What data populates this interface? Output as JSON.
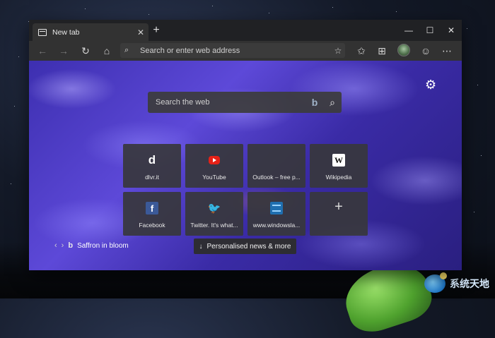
{
  "browser": {
    "tab": {
      "title": "New tab",
      "icon": "new-tab-page-icon"
    },
    "newtab_symbol": "+",
    "window_controls": {
      "minimize": "—",
      "maximize": "☐",
      "close": "✕"
    },
    "toolbar": {
      "back": "←",
      "forward": "→",
      "refresh": "↻",
      "home": "⌂",
      "address_placeholder": "Search or enter web address",
      "favorite": "☆",
      "favorites_hub": "✩",
      "collections": "⊞",
      "emoji": "☺",
      "more": "⋯"
    }
  },
  "newtab": {
    "search_placeholder": "Search the web",
    "bing_glyph": "b",
    "tiles": [
      {
        "label": "dlvr.it",
        "icon": "dlvr-d",
        "glyph": "d"
      },
      {
        "label": "YouTube",
        "icon": "youtube-icon",
        "glyph": ""
      },
      {
        "label": "Outlook – free p...",
        "icon": "microsoft-icon",
        "glyph": ""
      },
      {
        "label": "Wikipedia",
        "icon": "wikipedia-icon",
        "glyph": "W"
      },
      {
        "label": "Facebook",
        "icon": "facebook-icon",
        "glyph": "f"
      },
      {
        "label": "Twitter. It's what...",
        "icon": "twitter-icon",
        "glyph": "🐦"
      },
      {
        "label": "www.windowsla...",
        "icon": "windowsla-icon",
        "glyph": ""
      },
      {
        "label": "",
        "icon": "add-site-icon",
        "glyph": "+"
      }
    ],
    "caption": {
      "prev": "‹",
      "next": "›",
      "bing_glyph": "b",
      "text": "Saffron in bloom"
    },
    "news_button": {
      "arrow": "↓",
      "label": "Personalised news & more"
    },
    "settings_glyph": "⚙"
  },
  "watermark": {
    "text": "系统天地"
  },
  "colors": {
    "ms_red": "#f25022",
    "ms_green": "#7fba00",
    "ms_blue": "#00a4ef",
    "ms_yellow": "#ffb900"
  }
}
